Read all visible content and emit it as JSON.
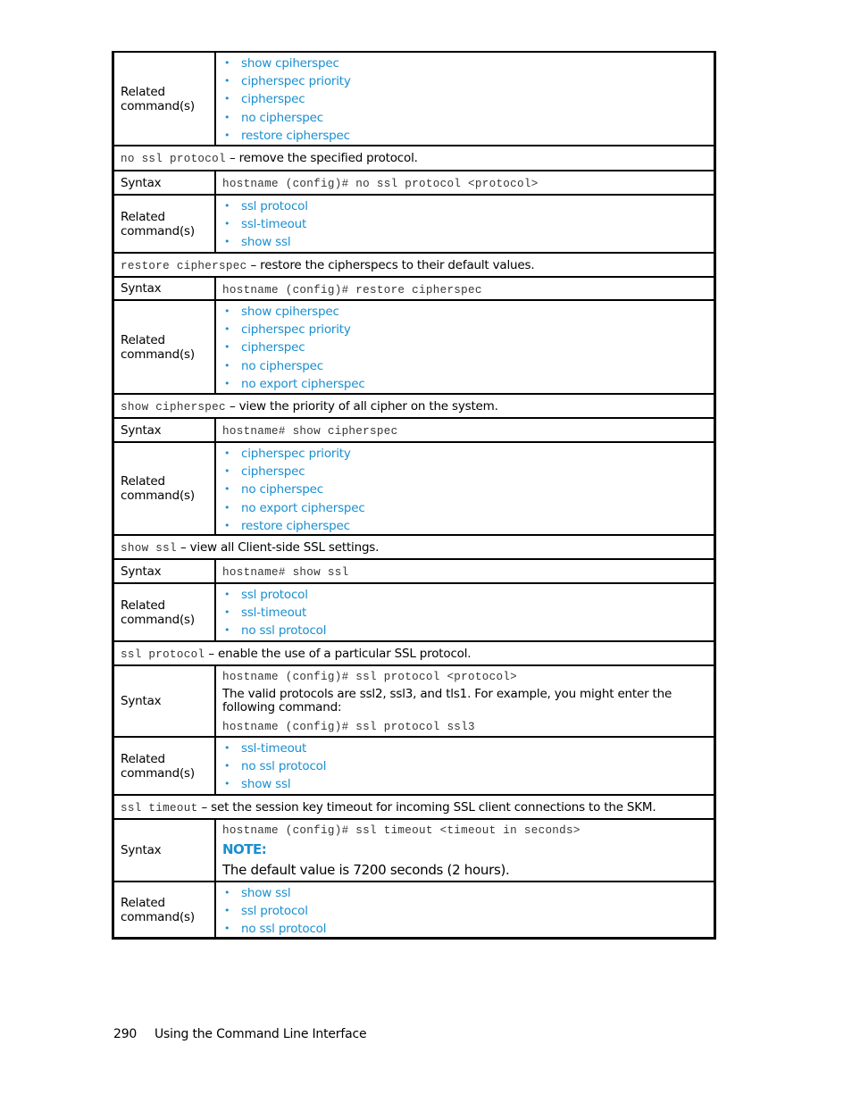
{
  "table": {
    "head_related": {
      "label": "Related command(s)",
      "links": [
        "show cpiherspec",
        "cipherspec priority",
        "cipherspec",
        "no cipherspec",
        "restore cipherspec"
      ]
    },
    "sections": [
      {
        "command": "no ssl protocol",
        "description": " – remove the specified protocol.",
        "syntax_label": "Syntax",
        "syntax": "hostname (config)# no ssl protocol <protocol>",
        "related_label": "Related command(s)",
        "related": [
          "ssl protocol",
          "ssl-timeout",
          "show ssl"
        ]
      },
      {
        "command": "restore cipherspec",
        "description": " – restore the cipherspecs to their default values.",
        "syntax_label": "Syntax",
        "syntax": "hostname (config)# restore cipherspec",
        "related_label": "Related command(s)",
        "related": [
          "show cpiherspec",
          "cipherspec priority",
          "cipherspec",
          "no cipherspec",
          "no export cipherspec"
        ]
      },
      {
        "command": "show cipherspec",
        "description": " – view the priority of all cipher on the system.",
        "syntax_label": "Syntax",
        "syntax": "hostname# show cipherspec",
        "related_label": "Related command(s)",
        "related": [
          "cipherspec priority",
          "cipherspec",
          "no cipherspec",
          "no export cipherspec",
          "restore cipherspec"
        ]
      },
      {
        "command": "show ssl",
        "description": " – view all Client-side SSL settings.",
        "syntax_label": "Syntax",
        "syntax": "hostname# show ssl",
        "related_label": "Related command(s)",
        "related": [
          "ssl protocol",
          "ssl-timeout",
          "no ssl protocol"
        ]
      },
      {
        "command": "ssl protocol",
        "description": " – enable the use of a particular SSL protocol.",
        "syntax_label": "Syntax",
        "syntax": "hostname (config)# ssl protocol <protocol>",
        "syntax_text": "The valid protocols are ssl2, ssl3, and tls1. For example, you might enter the following command:",
        "syntax_example": "hostname (config)# ssl protocol ssl3",
        "related_label": "Related command(s)",
        "related": [
          "ssl-timeout",
          "no ssl protocol",
          "show ssl"
        ]
      },
      {
        "command": "ssl timeout",
        "description": " – set the session key timeout for incoming SSL client connections to the SKM.",
        "syntax_label": "Syntax",
        "syntax": "hostname (config)# ssl timeout <timeout in seconds>",
        "note_title": "NOTE:",
        "note_text": "The default value is 7200 seconds (2 hours).",
        "related_label": "Related command(s)",
        "related": [
          "show ssl",
          "ssl protocol",
          "no ssl protocol"
        ]
      }
    ]
  },
  "footer": {
    "page_number": "290",
    "chapter_title": "Using the Command Line Interface"
  },
  "colors": {
    "link": "#1a8fd0",
    "border": "#000000"
  }
}
